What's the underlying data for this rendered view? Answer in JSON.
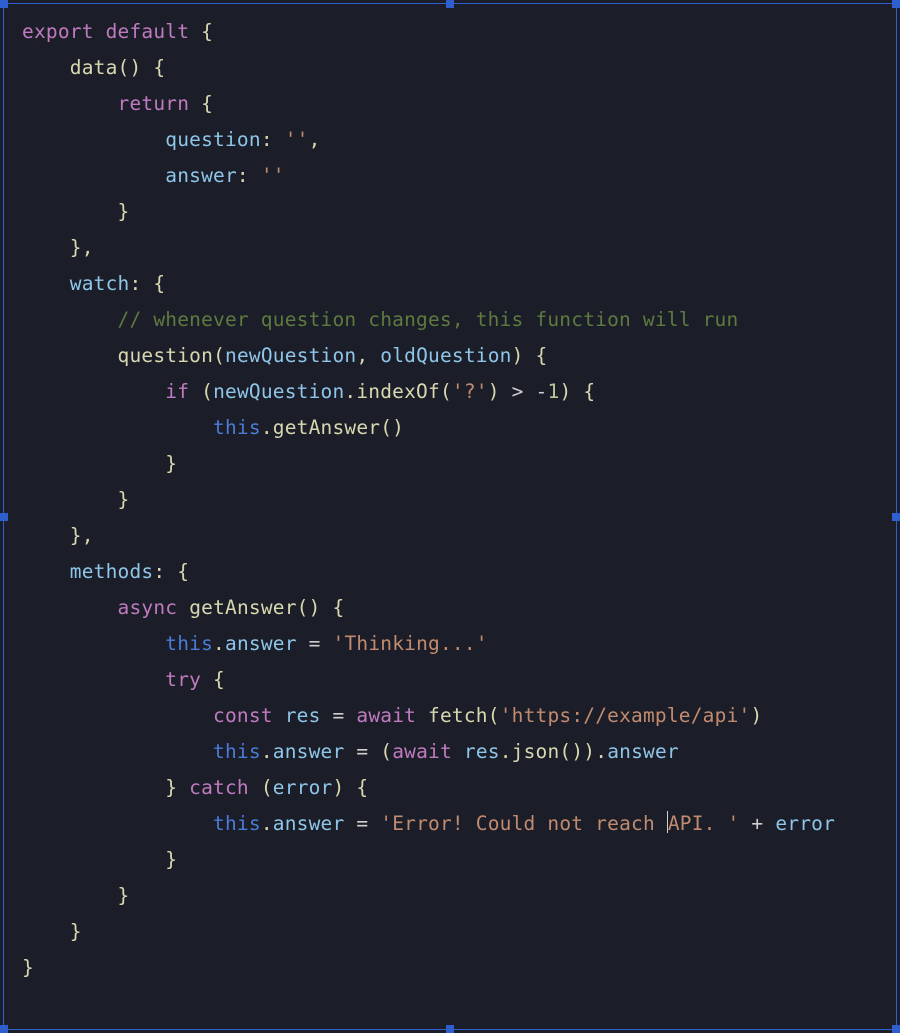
{
  "selection_handles": true,
  "cursor_line": 24,
  "cursor_after_text": "'Error! Could not reach ",
  "code": {
    "language": "javascript",
    "framework_hint": "Vue options API",
    "lines": [
      [
        [
          "kw",
          "export default"
        ],
        [
          "pun",
          " {"
        ]
      ],
      [
        [
          "pale",
          "    "
        ],
        [
          "fn",
          "data"
        ],
        [
          "pun",
          "() {"
        ]
      ],
      [
        [
          "pale",
          "        "
        ],
        [
          "kw",
          "return"
        ],
        [
          "pun",
          " {"
        ]
      ],
      [
        [
          "pale",
          "            "
        ],
        [
          "prop",
          "question"
        ],
        [
          "pun",
          ":"
        ],
        [
          "pale",
          " "
        ],
        [
          "str",
          "''"
        ],
        [
          "pun",
          ","
        ]
      ],
      [
        [
          "pale",
          "            "
        ],
        [
          "prop",
          "answer"
        ],
        [
          "pun",
          ":"
        ],
        [
          "pale",
          " "
        ],
        [
          "str",
          "''"
        ]
      ],
      [
        [
          "pale",
          "        "
        ],
        [
          "pun",
          "}"
        ]
      ],
      [
        [
          "pale",
          "    "
        ],
        [
          "pun",
          "},"
        ]
      ],
      [
        [
          "pale",
          "    "
        ],
        [
          "prop",
          "watch"
        ],
        [
          "pun",
          ": {"
        ]
      ],
      [
        [
          "pale",
          "        "
        ],
        [
          "cmt",
          "// whenever question changes, this function will run"
        ]
      ],
      [
        [
          "pale",
          "        "
        ],
        [
          "fn",
          "question"
        ],
        [
          "pun",
          "("
        ],
        [
          "prop",
          "newQuestion"
        ],
        [
          "pun",
          ", "
        ],
        [
          "prop",
          "oldQuestion"
        ],
        [
          "pun",
          ") {"
        ]
      ],
      [
        [
          "pale",
          "            "
        ],
        [
          "kw",
          "if"
        ],
        [
          "pun",
          " ("
        ],
        [
          "prop",
          "newQuestion"
        ],
        [
          "pun",
          "."
        ],
        [
          "fn",
          "indexOf"
        ],
        [
          "pun",
          "("
        ],
        [
          "str",
          "'?'"
        ],
        [
          "pun",
          ") "
        ],
        [
          "op",
          ">"
        ],
        [
          "pale",
          " "
        ],
        [
          "op",
          "-"
        ],
        [
          "num",
          "1"
        ],
        [
          "pun",
          ") {"
        ]
      ],
      [
        [
          "pale",
          "                "
        ],
        [
          "kw2",
          "this"
        ],
        [
          "pun",
          "."
        ],
        [
          "fn",
          "getAnswer"
        ],
        [
          "pun",
          "()"
        ]
      ],
      [
        [
          "pale",
          "            "
        ],
        [
          "pun",
          "}"
        ]
      ],
      [
        [
          "pale",
          "        "
        ],
        [
          "pun",
          "}"
        ]
      ],
      [
        [
          "pale",
          "    "
        ],
        [
          "pun",
          "},"
        ]
      ],
      [
        [
          "pale",
          "    "
        ],
        [
          "prop",
          "methods"
        ],
        [
          "pun",
          ": {"
        ]
      ],
      [
        [
          "pale",
          "        "
        ],
        [
          "kw",
          "async"
        ],
        [
          "pale",
          " "
        ],
        [
          "fn",
          "getAnswer"
        ],
        [
          "pun",
          "() {"
        ]
      ],
      [
        [
          "pale",
          "            "
        ],
        [
          "kw2",
          "this"
        ],
        [
          "pun",
          "."
        ],
        [
          "prop",
          "answer"
        ],
        [
          "pale",
          " "
        ],
        [
          "op",
          "="
        ],
        [
          "pale",
          " "
        ],
        [
          "str",
          "'Thinking...'"
        ]
      ],
      [
        [
          "pale",
          "            "
        ],
        [
          "kw",
          "try"
        ],
        [
          "pun",
          " {"
        ]
      ],
      [
        [
          "pale",
          "                "
        ],
        [
          "kw",
          "const"
        ],
        [
          "pale",
          " "
        ],
        [
          "prop",
          "res"
        ],
        [
          "pale",
          " "
        ],
        [
          "op",
          "="
        ],
        [
          "pale",
          " "
        ],
        [
          "kw",
          "await"
        ],
        [
          "pale",
          " "
        ],
        [
          "fn",
          "fetch"
        ],
        [
          "pun",
          "("
        ],
        [
          "str",
          "'https://example/api'"
        ],
        [
          "pun",
          ")"
        ]
      ],
      [
        [
          "pale",
          "                "
        ],
        [
          "kw2",
          "this"
        ],
        [
          "pun",
          "."
        ],
        [
          "prop",
          "answer"
        ],
        [
          "pale",
          " "
        ],
        [
          "op",
          "="
        ],
        [
          "pale",
          " "
        ],
        [
          "pun",
          "("
        ],
        [
          "kw",
          "await"
        ],
        [
          "pale",
          " "
        ],
        [
          "prop",
          "res"
        ],
        [
          "pun",
          "."
        ],
        [
          "fn",
          "json"
        ],
        [
          "pun",
          "())."
        ],
        [
          "prop",
          "answer"
        ]
      ],
      [
        [
          "pale",
          "            "
        ],
        [
          "pun",
          "} "
        ],
        [
          "kw",
          "catch"
        ],
        [
          "pun",
          " ("
        ],
        [
          "prop",
          "error"
        ],
        [
          "pun",
          ") {"
        ]
      ],
      [
        [
          "pale",
          "                "
        ],
        [
          "kw2",
          "this"
        ],
        [
          "pun",
          "."
        ],
        [
          "prop",
          "answer"
        ],
        [
          "pale",
          " "
        ],
        [
          "op",
          "="
        ],
        [
          "pale",
          " "
        ],
        [
          "str",
          "'Error! Could not reach "
        ],
        [
          "cursor",
          ""
        ],
        [
          "str",
          "API. '"
        ],
        [
          "pale",
          " "
        ],
        [
          "op",
          "+"
        ],
        [
          "pale",
          " "
        ],
        [
          "prop",
          "error"
        ]
      ],
      [
        [
          "pale",
          "            "
        ],
        [
          "pun",
          "}"
        ]
      ],
      [
        [
          "pale",
          "        "
        ],
        [
          "pun",
          "}"
        ]
      ],
      [
        [
          "pale",
          "    "
        ],
        [
          "pun",
          "}"
        ]
      ],
      [
        [
          "pun",
          "}"
        ]
      ]
    ]
  }
}
